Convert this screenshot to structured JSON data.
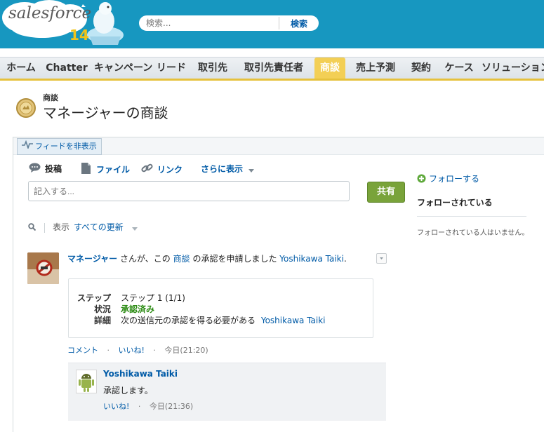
{
  "header": {
    "logo_word": "salesforce",
    "logo_version": "14",
    "search_placeholder": "検索...",
    "search_button": "検索"
  },
  "tabs": [
    {
      "label": "ホーム"
    },
    {
      "label": "Chatter"
    },
    {
      "label": "キャンペーン"
    },
    {
      "label": "リード"
    },
    {
      "label": "取引先"
    },
    {
      "label": "取引先責任者"
    },
    {
      "label": "商談",
      "active": true
    },
    {
      "label": "売上予測"
    },
    {
      "label": "契約"
    },
    {
      "label": "ケース"
    },
    {
      "label": "ソリューション"
    }
  ],
  "page": {
    "type_label": "商談",
    "title": "マネージャーの商談"
  },
  "feed": {
    "hide_feed": "フィードを非表示",
    "publisher": {
      "post": "投稿",
      "file": "ファイル",
      "link": "リンク",
      "more": "さらに表示",
      "input_placeholder": "記入する...",
      "share": "共有"
    },
    "filter": {
      "show_label": "表示",
      "value": "すべての更新"
    },
    "item": {
      "actor": "マネージャー",
      "text_1": "さんが、この",
      "object": "商談",
      "text_2": "の承認を申請しました",
      "target": "Yoshikawa Taiki",
      "period": ".",
      "approval": {
        "step_label": "ステップ",
        "step_value": "ステップ 1 (1/1)",
        "status_label": "状況",
        "status_value": "承認済み",
        "detail_label": "詳細",
        "detail_value": "次の送信元の承認を得る必要がある",
        "detail_link": "Yoshikawa Taiki"
      },
      "actions": {
        "comment": "コメント",
        "like": "いいね!",
        "time": "今日(21:20)"
      },
      "comment": {
        "author": "Yoshikawa Taiki",
        "text": "承認します。",
        "like": "いいね!",
        "time": "今日(21:36)"
      }
    }
  },
  "sidebar": {
    "follow": "フォローする",
    "followers_heading": "フォローされている",
    "followers_empty": "フォローされている人はいません。"
  },
  "colors": {
    "header": "#1797c0",
    "active_tab": "#f3cf55",
    "share": "#79a33a",
    "approved": "#2a8a12",
    "link": "#015ba7"
  }
}
